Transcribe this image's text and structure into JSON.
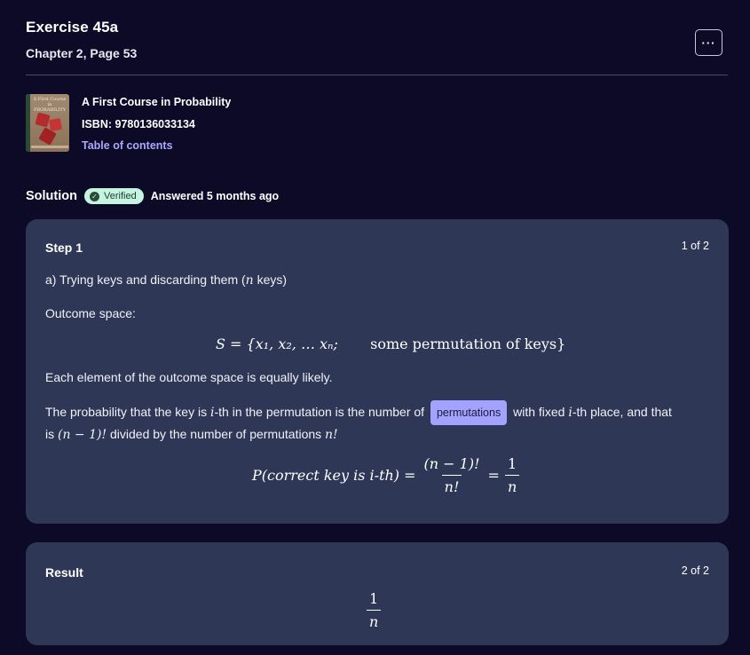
{
  "header": {
    "title": "Exercise 45a",
    "subtitle": "Chapter 2, Page 53",
    "more_label": "···"
  },
  "book": {
    "cover_text": "A First Course in PROBABILITY",
    "title": "A First Course in Probability",
    "isbn": "ISBN: 9780136033134",
    "toc_label": "Table of contents"
  },
  "solution": {
    "label": "Solution",
    "badge": "Verified",
    "answered": "Answered 5 months ago"
  },
  "step1": {
    "title": "Step 1",
    "count": "1 of 2",
    "line1_prefix": "a) Trying keys and discarding them (",
    "line1_var": "n",
    "line1_suffix": " keys)",
    "outcome_label": "Outcome space:",
    "outcome_eq": "S = {x₁, x₂, … xₙ;",
    "outcome_text": "some permutation of keys}",
    "equally_likely": "Each element of the outcome space is equally likely.",
    "prob_text_1": "The probability that the key is ",
    "prob_var_i": "i",
    "prob_text_2": "-th in the permutation is the number of",
    "permutations_chip": "permutations",
    "prob_text_3": "with fixed ",
    "prob_text_4": "-th place, and that",
    "prob_line2_1": "is ",
    "prob_line2_math": "(n − 1)!",
    "prob_line2_2": " divided by the number of permutations ",
    "prob_line2_n": "n!",
    "eq_lhs": "P(correct key is i-th) =",
    "eq_frac1_num": "(n − 1)!",
    "eq_frac1_den": "n!",
    "eq_equals": "=",
    "eq_frac2_num": "1",
    "eq_frac2_den": "n"
  },
  "result": {
    "title": "Result",
    "count": "2 of 2",
    "num": "1",
    "den": "n"
  },
  "colors": {
    "background": "#0c0a26",
    "card": "#2e3856",
    "accent_link": "#a9a8ff",
    "chip": "#a4a2ff",
    "verified_badge": "#c5f4e0"
  }
}
